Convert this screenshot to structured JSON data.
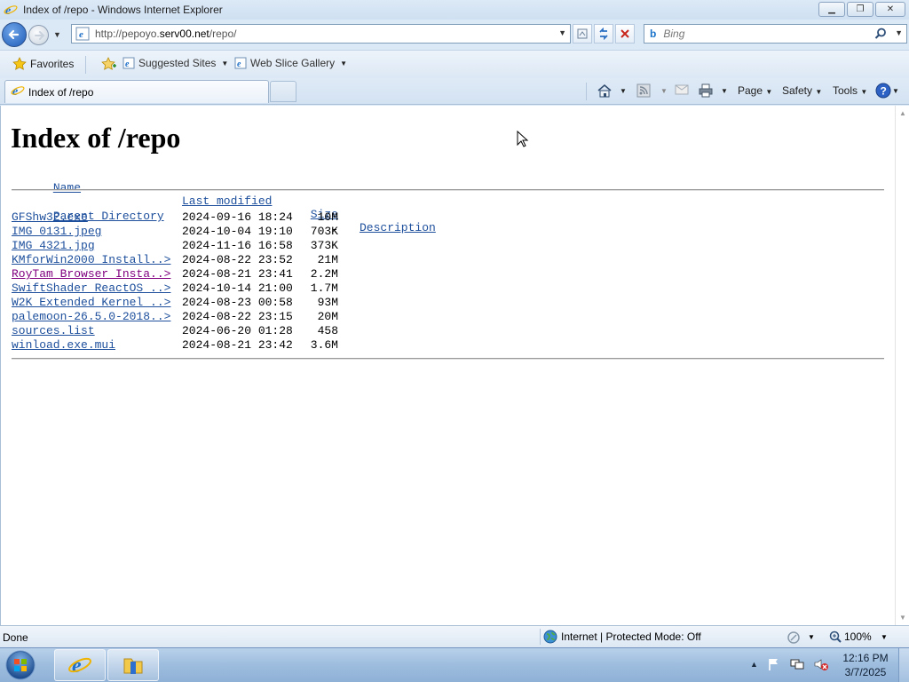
{
  "window": {
    "title": "Index of /repo - Windows Internet Explorer"
  },
  "address": {
    "url_prefix": "http://pepoyo.",
    "url_domain": "serv00.net",
    "url_suffix": "/repo/"
  },
  "search": {
    "provider": "b",
    "placeholder": "Bing"
  },
  "favorites_bar": {
    "favorites_label": "Favorites",
    "suggested_label": "Suggested Sites",
    "webslice_label": "Web Slice Gallery"
  },
  "tabs": [
    {
      "label": "Index of /repo"
    }
  ],
  "command_bar": {
    "page_label": "Page",
    "safety_label": "Safety",
    "tools_label": "Tools"
  },
  "page": {
    "heading": "Index of /repo",
    "headers": {
      "name": "Name",
      "modified": "Last modified",
      "size": "Size",
      "description": "Description"
    },
    "parent": {
      "name": "Parent Directory",
      "size": "-"
    },
    "files": [
      {
        "name": "GFShw32.exe",
        "modified": "2024-09-16 18:24",
        "size": "10M"
      },
      {
        "name": "IMG_0131.jpeg",
        "modified": "2024-10-04 19:10",
        "size": "703K"
      },
      {
        "name": "IMG_4321.jpg",
        "modified": "2024-11-16 16:58",
        "size": "373K"
      },
      {
        "name": "KMforWin2000_Install..>",
        "modified": "2024-08-22 23:52",
        "size": "21M"
      },
      {
        "name": "RoyTam Browser Insta..>",
        "modified": "2024-08-21 23:41",
        "size": "2.2M",
        "visited": true
      },
      {
        "name": "SwiftShader_ReactOS_..>",
        "modified": "2024-10-14 21:00",
        "size": "1.7M"
      },
      {
        "name": "W2K Extended Kernel ..>",
        "modified": "2024-08-23 00:58",
        "size": "93M"
      },
      {
        "name": "palemoon-26.5.0-2018..>",
        "modified": "2024-08-22 23:15",
        "size": "20M"
      },
      {
        "name": "sources.list",
        "modified": "2024-06-20 01:28",
        "size": "458"
      },
      {
        "name": "winload.exe.mui",
        "modified": "2024-08-21 23:42",
        "size": "3.6M"
      }
    ]
  },
  "status": {
    "text": "Done",
    "zone": "Internet | Protected Mode: Off",
    "zoom": "100%"
  },
  "taskbar": {
    "time": "12:16 PM",
    "date": "3/7/2025"
  },
  "colors": {
    "link": "#1d4f9c",
    "visited_link": "#800080",
    "chrome": "#dbe8f5"
  }
}
